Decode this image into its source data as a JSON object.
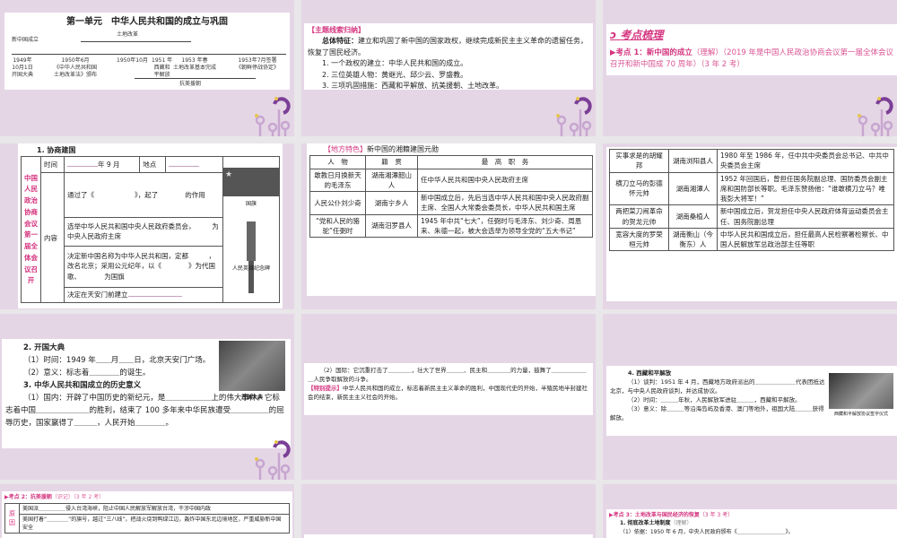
{
  "slides": {
    "s1": {
      "title": "第一单元　中华人民共和国的成立与巩固",
      "top_left": "新中国成立",
      "land_reform": "土地改革",
      "events": [
        "1949年\n10月1日\n开国大典",
        "1950年6月\n《中华人民共和国\n土地改革法》颁布",
        "1950年10月",
        "1951 年\n西藏和\n平解放",
        "1953 年春\n土地改革基本完成",
        "1953年7月签署\n《朝鲜停战协定》"
      ],
      "korea": "抗美援朝"
    },
    "s2": {
      "tag": "【主题线索归纳】",
      "feature_label": "总体特征：",
      "feature_text": "建立和巩固了新中国的国家政权，继续完成新民主主义革命的遗留任务，恢复了国民经济。",
      "items": [
        "1. 一个政权的建立：中华人民共和国的成立。",
        "2. 三位英雄人物：黄继光、邱少云、罗盛教。",
        "3. 三项巩固措施：西藏和平解放、抗美援朝、土地改革。"
      ]
    },
    "s3": {
      "heading": "考点梳理",
      "point_label": "考点 1：新中国的成立",
      "point_detail": "（理解）（2019 年是中国人民政治协商会议第一届全体会议召开和新中国成 70 周年）（3 年 2 考）"
    },
    "s4": {
      "heading": "1. 协商建国",
      "side": "中国人民政治协商会议第一届全体会议召开",
      "time": "时间",
      "month": "年 9 月",
      "place": "地点",
      "content": "内容",
      "rows": [
        "通过了《　　　　　　》，起了　　　　的作用",
        "选举中华人民共和国中央人民政府委员会，　　　为中央人民政府主席",
        "决定新中国名称为中华人民共和国，定都　　　，改名北京；采用公元纪年，以《　　　　》为代国歌、　　　　为国旗",
        "决定在天安门前建立"
      ],
      "flag_caption": "国旗",
      "monument_caption": "人民英雄纪念碑"
    },
    "s5": {
      "tag": "【地方特色】",
      "title": "新中国的湘籍建国元勋",
      "headers": [
        "人　物",
        "籍　贯",
        "最　高　职　务"
      ],
      "rows": [
        [
          "敢教日月换新天的毛泽东",
          "湖南湘潭韶山人",
          "任中华人民共和国中央人民政府主席"
        ],
        [
          "人民公仆刘少奇",
          "湖南宁乡人",
          "新中国成立后，先后当选中华人民共和国中央人民政府副主席、全国人大常委会委员长，中华人民共和国主席"
        ],
        [
          "“党和人民的骆驼”任弼时",
          "湖南汨罗县人",
          "1945 年中共“七大”，任弼时与毛泽东、刘少奇、周恩来、朱德一起，被大会选举为领导全党的“五大书记”"
        ]
      ]
    },
    "s6": {
      "rows": [
        [
          "实事求是的胡耀邦",
          "湖南浏阳县人",
          "1980 年至 1986 年，任中共中央委员会总书记、中共中央委员会主席"
        ],
        [
          "横刀立马的彭德怀元帅",
          "湖南湘潭人",
          "1952 年回国后，曾担任国务院副总理、国防委员会副主席和国防部长等职。毛泽东赞扬他：“谁敢横刀立马？唯我彭大将军！”"
        ],
        [
          "两把菜刀闹革命的贺龙元帅",
          "湖南桑植人",
          "新中国成立后，贺龙担任中央人民政府体育运动委员会主任、国务院副总理"
        ],
        [
          "宽容大度的罗荣桓元帅",
          "湖南衡山（今衡东）人",
          "中华人民共和国成立后，担任最高人民检察署检察长、中国人民解放军总政治部主任等职"
        ]
      ]
    },
    "s7": {
      "h2": "2. 开国大典",
      "l1": "（1）时间：1949 年＿＿月＿＿日，北京天安门广场。",
      "l2": "（2）意义：标志着＿＿＿＿的诞生。",
      "h3": "3. 中华人民共和国成立的历史意义",
      "p": "（1）国内：开辟了中国历史的新纪元，是＿＿＿＿＿＿上的伟大事件。它标志着中国＿＿＿＿＿＿＿的胜利，结束了 100 多年来中华民族遭受＿＿＿＿＿的屈辱历史，国家赢得了＿＿＿，人民开始＿＿＿＿。",
      "caption": "开国大典"
    },
    "s8": {
      "p": "（2）国际：它沉重打击了＿＿＿＿，壮大了世界＿＿＿、民主和＿＿＿＿的力量，鼓舞了＿＿＿＿＿＿＿人民争取解放的斗争。",
      "tag": "【特别提示】",
      "tip": "中华人民共和国的成立，标志着新民主主义革命的胜利，中国现代史的开始，半殖民地半封建社会的结束，新民主主义社会的开始。"
    },
    "s9": {
      "h": "4. 西藏和平解放",
      "l1": "（1）谈判：1951 年 4 月，西藏地方政府派出的＿＿＿＿＿＿＿代表团抵达北京，与中央人民政府谈判，并达成协议。",
      "l2": "（2）时间：＿＿＿年秋，人民解放军进驻＿＿＿，西藏和平解放。",
      "l3": "（3）意义：除＿＿＿等沿海岛屿及香港、澳门等地外，祖国大陆＿＿＿获得解放。",
      "caption": "西藏和平解放协议签字仪式"
    },
    "s10": {
      "point": "考点 2：抗美援朝",
      "detail": "（识记）（3 年 2 考）",
      "side": "原因",
      "r1": "美国派＿＿＿＿＿侵入台湾海峡，阻止中国人民解放军解放台湾，干涉中国内政",
      "r2": "美国打着“＿＿＿＿”的旗号，越过“三八线”，把战火烧到鸭绿江边，轰炸中国东北边境地区，严重威胁新中国安全"
    },
    "s12": {
      "point": "考点 3：土地改革与国民经济的恢复",
      "detail": "（3 年 3 考）",
      "h": "1. 彻底改革土地制度",
      "h_detail": "（理解）",
      "l1": "（1）依据：1950 年 6 月，中央人民政府颁布《＿＿＿＿＿＿＿＿＿》。"
    }
  },
  "colors": {
    "accent": "#d4357f",
    "slide_bg": "#e5d6e6",
    "page_bg": "#e9e7e9"
  }
}
